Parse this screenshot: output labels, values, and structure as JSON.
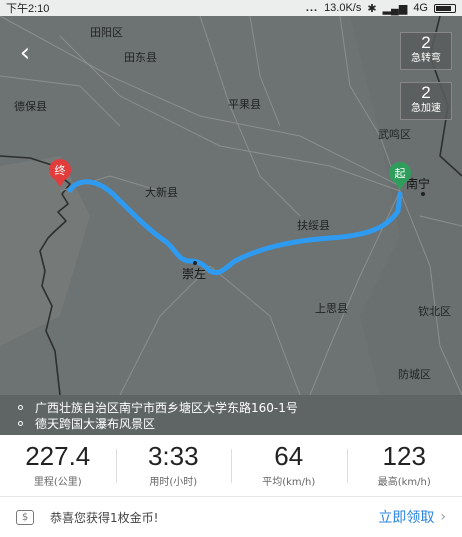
{
  "status_bar": {
    "time": "下午2:10",
    "dots": "...",
    "speed": "13.0K/s",
    "network": "4G"
  },
  "map": {
    "places": [
      {
        "name": "田阳区"
      },
      {
        "name": "田东县"
      },
      {
        "name": "德保县"
      },
      {
        "name": "平果县"
      },
      {
        "name": "武鸣区"
      },
      {
        "name": "大新县"
      },
      {
        "name": "南宁"
      },
      {
        "name": "扶绥县"
      },
      {
        "name": "崇左"
      },
      {
        "name": "上思县"
      },
      {
        "name": "钦北区"
      },
      {
        "name": "防城区"
      }
    ],
    "start_marker": "起",
    "end_marker": "终",
    "route_color": "#2f9bf0",
    "start_color": "#2f9e5c",
    "end_color": "#e23d3d"
  },
  "boxes": {
    "turns": {
      "value": "2",
      "label": "急转弯"
    },
    "accel": {
      "value": "2",
      "label": "急加速"
    }
  },
  "addresses": {
    "from": "广西壮族自治区南宁市西乡塘区大学东路160-1号",
    "to": "德天跨国大瀑布风景区"
  },
  "stats": [
    {
      "value": "227.4",
      "label": "里程(公里)"
    },
    {
      "value": "3:33",
      "label": "用时(小时)"
    },
    {
      "value": "64",
      "label": "平均(km/h)"
    },
    {
      "value": "123",
      "label": "最高(km/h)"
    }
  ],
  "coin": {
    "icon_text": "$",
    "message": "恭喜您获得1枚金币!",
    "action": "立即领取"
  }
}
